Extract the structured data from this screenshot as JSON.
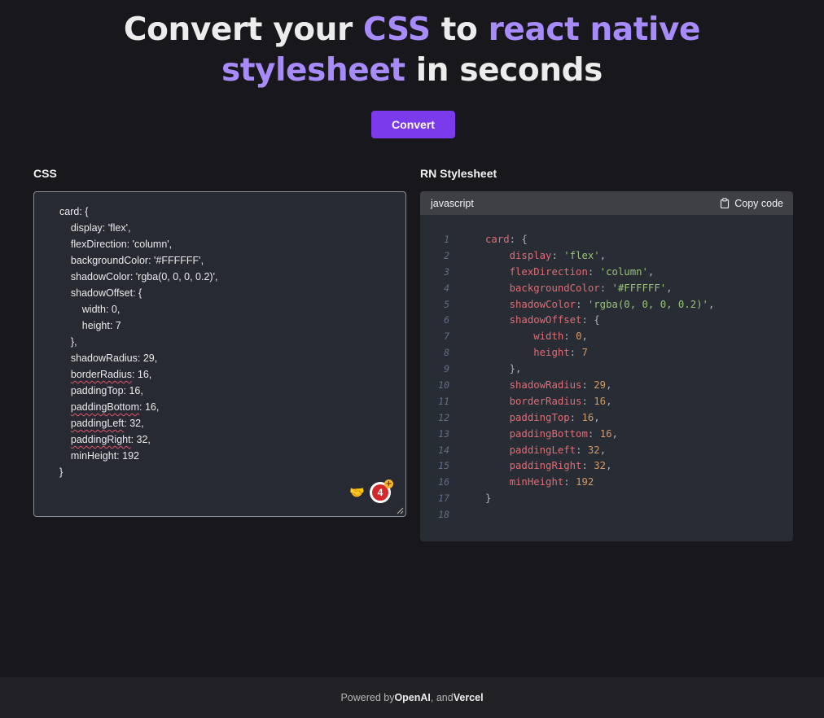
{
  "hero": {
    "part1": "Convert your ",
    "css": "CSS",
    "part2": " to ",
    "rn": "react native",
    "sheet": "stylesheet",
    "part3": " in seconds"
  },
  "convert_label": "Convert",
  "left_panel": {
    "label": "CSS",
    "lines": [
      {
        "pre": "card: {",
        "word": "",
        "post": ""
      },
      {
        "pre": "    display: 'flex',",
        "word": "",
        "post": ""
      },
      {
        "pre": "    flexDirection: 'column',",
        "word": "",
        "post": ""
      },
      {
        "pre": "    backgroundColor: '#FFFFFF',",
        "word": "",
        "post": ""
      },
      {
        "pre": "    shadowColor: 'rgba(0, 0, 0, 0.2)',",
        "word": "",
        "post": ""
      },
      {
        "pre": "    shadowOffset: {",
        "word": "",
        "post": ""
      },
      {
        "pre": "        width: 0,",
        "word": "",
        "post": ""
      },
      {
        "pre": "        height: 7",
        "word": "",
        "post": ""
      },
      {
        "pre": "    },",
        "word": "",
        "post": ""
      },
      {
        "pre": "    shadowRadius: 29,",
        "word": "",
        "post": ""
      },
      {
        "pre": "    ",
        "word": "borderRadius",
        "post": ": 16,"
      },
      {
        "pre": "    paddingTop: 16,",
        "word": "",
        "post": ""
      },
      {
        "pre": "    ",
        "word": "paddingBottom",
        "post": ": 16,"
      },
      {
        "pre": "    ",
        "word": "paddingLeft",
        "post": ": 32,"
      },
      {
        "pre": "    ",
        "word": "paddingRight",
        "post": ": 32,"
      },
      {
        "pre": "    minHeight: 192",
        "word": "",
        "post": ""
      },
      {
        "pre": "}",
        "word": "",
        "post": ""
      }
    ],
    "badge_count": "4"
  },
  "right_panel": {
    "label": "RN Stylesheet",
    "language": "javascript",
    "copy_label": "Copy code",
    "line_numbers": [
      "1",
      "2",
      "3",
      "4",
      "5",
      "6",
      "7",
      "8",
      "9",
      "10",
      "11",
      "12",
      "13",
      "14",
      "15",
      "16",
      "17",
      "18"
    ],
    "code_lines": [
      [
        {
          "c": "key",
          "t": "card"
        },
        {
          "c": "pun",
          "t": ": {"
        }
      ],
      [
        {
          "c": "pun",
          "t": "    "
        },
        {
          "c": "key",
          "t": "display"
        },
        {
          "c": "pun",
          "t": ": "
        },
        {
          "c": "str",
          "t": "'flex'"
        },
        {
          "c": "pun",
          "t": ","
        }
      ],
      [
        {
          "c": "pun",
          "t": "    "
        },
        {
          "c": "key",
          "t": "flexDirection"
        },
        {
          "c": "pun",
          "t": ": "
        },
        {
          "c": "str",
          "t": "'column'"
        },
        {
          "c": "pun",
          "t": ","
        }
      ],
      [
        {
          "c": "pun",
          "t": "    "
        },
        {
          "c": "key",
          "t": "backgroundColor"
        },
        {
          "c": "pun",
          "t": ": "
        },
        {
          "c": "str",
          "t": "'#FFFFFF'"
        },
        {
          "c": "pun",
          "t": ","
        }
      ],
      [
        {
          "c": "pun",
          "t": "    "
        },
        {
          "c": "key",
          "t": "shadowColor"
        },
        {
          "c": "pun",
          "t": ": "
        },
        {
          "c": "str",
          "t": "'rgba(0, 0, 0, 0.2)'"
        },
        {
          "c": "pun",
          "t": ","
        }
      ],
      [
        {
          "c": "pun",
          "t": "    "
        },
        {
          "c": "key",
          "t": "shadowOffset"
        },
        {
          "c": "pun",
          "t": ": {"
        }
      ],
      [
        {
          "c": "pun",
          "t": "        "
        },
        {
          "c": "key",
          "t": "width"
        },
        {
          "c": "pun",
          "t": ": "
        },
        {
          "c": "num",
          "t": "0"
        },
        {
          "c": "pun",
          "t": ","
        }
      ],
      [
        {
          "c": "pun",
          "t": "        "
        },
        {
          "c": "key",
          "t": "height"
        },
        {
          "c": "pun",
          "t": ": "
        },
        {
          "c": "num",
          "t": "7"
        }
      ],
      [
        {
          "c": "pun",
          "t": "    },"
        }
      ],
      [
        {
          "c": "pun",
          "t": "    "
        },
        {
          "c": "key",
          "t": "shadowRadius"
        },
        {
          "c": "pun",
          "t": ": "
        },
        {
          "c": "num",
          "t": "29"
        },
        {
          "c": "pun",
          "t": ","
        }
      ],
      [
        {
          "c": "pun",
          "t": "    "
        },
        {
          "c": "key",
          "t": "borderRadius"
        },
        {
          "c": "pun",
          "t": ": "
        },
        {
          "c": "num",
          "t": "16"
        },
        {
          "c": "pun",
          "t": ","
        }
      ],
      [
        {
          "c": "pun",
          "t": "    "
        },
        {
          "c": "key",
          "t": "paddingTop"
        },
        {
          "c": "pun",
          "t": ": "
        },
        {
          "c": "num",
          "t": "16"
        },
        {
          "c": "pun",
          "t": ","
        }
      ],
      [
        {
          "c": "pun",
          "t": "    "
        },
        {
          "c": "key",
          "t": "paddingBottom"
        },
        {
          "c": "pun",
          "t": ": "
        },
        {
          "c": "num",
          "t": "16"
        },
        {
          "c": "pun",
          "t": ","
        }
      ],
      [
        {
          "c": "pun",
          "t": "    "
        },
        {
          "c": "key",
          "t": "paddingLeft"
        },
        {
          "c": "pun",
          "t": ": "
        },
        {
          "c": "num",
          "t": "32"
        },
        {
          "c": "pun",
          "t": ","
        }
      ],
      [
        {
          "c": "pun",
          "t": "    "
        },
        {
          "c": "key",
          "t": "paddingRight"
        },
        {
          "c": "pun",
          "t": ": "
        },
        {
          "c": "num",
          "t": "32"
        },
        {
          "c": "pun",
          "t": ","
        }
      ],
      [
        {
          "c": "pun",
          "t": "    "
        },
        {
          "c": "key",
          "t": "minHeight"
        },
        {
          "c": "pun",
          "t": ": "
        },
        {
          "c": "num",
          "t": "192"
        }
      ],
      [
        {
          "c": "pun",
          "t": "}"
        }
      ],
      []
    ]
  },
  "footer": {
    "prefix": "Powered by ",
    "openai": "OpenAI",
    "mid": ", and ",
    "vercel": "Vercel"
  },
  "colors": {
    "accent": "#a78bfa",
    "button": "#7c3aed",
    "background": "#18171b",
    "code_bg": "#282c34"
  },
  "icons": {
    "copy": "clipboard-icon",
    "extension_a": "handshake-icon",
    "extension_b": "badge-icon"
  }
}
